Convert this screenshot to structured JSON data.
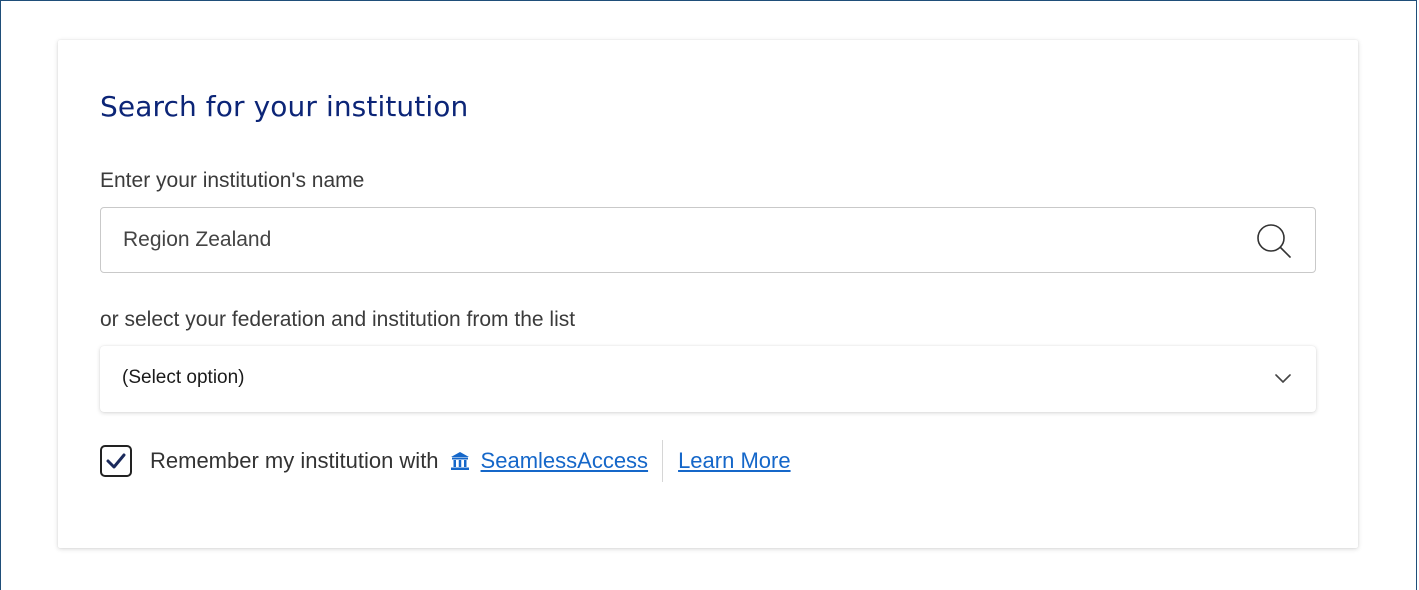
{
  "card": {
    "title": "Search for your institution"
  },
  "search": {
    "label": "Enter your institution's name",
    "value": "Region Zealand",
    "icon": "search-icon"
  },
  "federation": {
    "label": "or select your federation and institution from the list",
    "selected": "(Select option)",
    "icon": "chevron-down-icon"
  },
  "remember": {
    "checked": true,
    "text": "Remember my institution with",
    "brand_icon": "institution-icon",
    "brand_link": "SeamlessAccess",
    "learn_more": "Learn More"
  },
  "colors": {
    "title": "#0c2577",
    "link": "#1567c9",
    "frame_border": "#1f4e79"
  }
}
